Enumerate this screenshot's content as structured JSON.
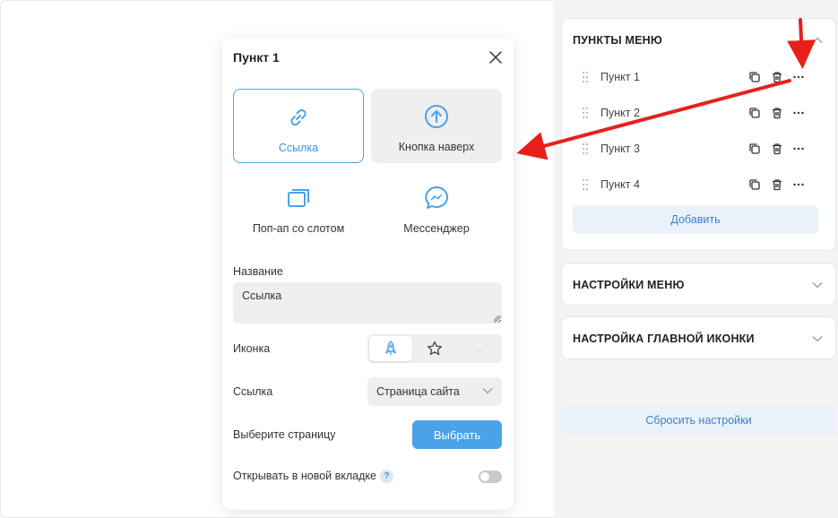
{
  "popup": {
    "title": "Пункт 1",
    "types": [
      {
        "label": "Ссылка",
        "icon": "link-icon",
        "selected": true
      },
      {
        "label": "Кнопка наверх",
        "icon": "arrow-up-circle-icon",
        "selected": false
      },
      {
        "label": "Поп-ап со слотом",
        "icon": "popup-windows-icon",
        "selected": false
      },
      {
        "label": "Мессенджер",
        "icon": "messenger-icon",
        "selected": false
      }
    ],
    "name_label": "Название",
    "name_value": "Ссылка",
    "icon_label": "Иконка",
    "icon_options": [
      "rocket-icon",
      "star-icon",
      "more-icon"
    ],
    "icon_more": "...",
    "link_label": "Ссылка",
    "link_value": "Страница сайта",
    "page_label": "Выберите страницу",
    "choose_button": "Выбрать",
    "new_tab_label": "Открывать в новой вкладке",
    "help_mark": "?",
    "new_tab_enabled": false
  },
  "panel": {
    "menu_items_title": "ПУНКТЫ МЕНЮ",
    "items": [
      {
        "label": "Пункт 1"
      },
      {
        "label": "Пункт 2"
      },
      {
        "label": "Пункт 3"
      },
      {
        "label": "Пункт 4"
      }
    ],
    "add_button": "Добавить",
    "menu_settings_title": "НАСТРОЙКИ МЕНЮ",
    "main_icon_title": "НАСТРОЙКА ГЛАВНОЙ ИКОНКИ",
    "reset_button": "Сбросить настройки"
  },
  "colors": {
    "accent": "#4aa3e8",
    "annotation_arrow": "#e8201a"
  }
}
